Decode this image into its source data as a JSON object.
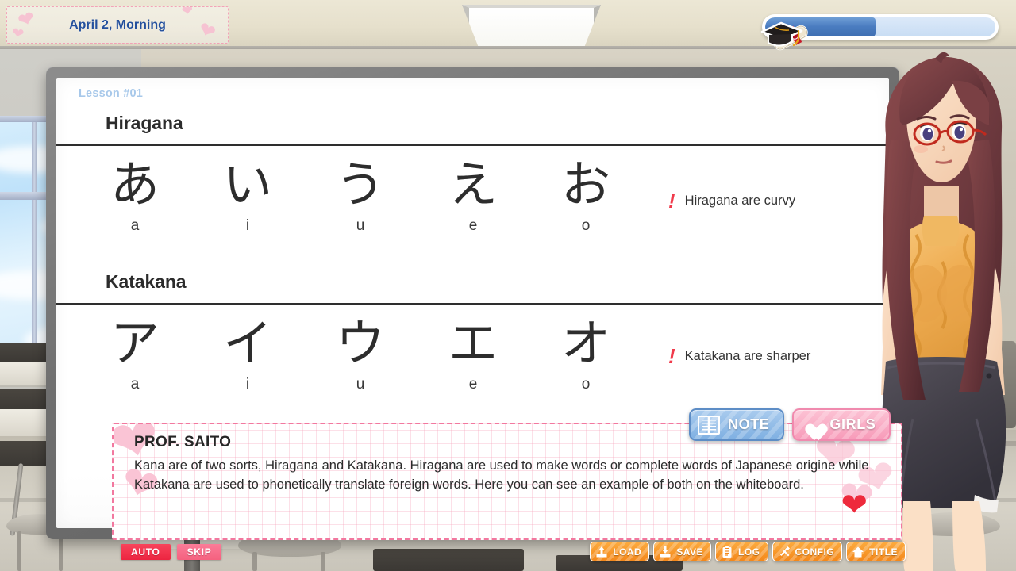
{
  "hud": {
    "date_label": "April 2, Morning",
    "progress_percent": 48,
    "progress_icon": "graduation-cap-diploma-icon",
    "progress_fill_color": "#4a7cc0",
    "progress_track_color": "#cfe0f5"
  },
  "whiteboard": {
    "lesson_label": "Lesson #01",
    "lesson_color": "#a7c8ea",
    "sections": [
      {
        "title": "Hiragana",
        "note_mark": "!",
        "note_text": "Hiragana are curvy",
        "kana": [
          {
            "glyph": "あ",
            "romaji": "a"
          },
          {
            "glyph": "い",
            "romaji": "i"
          },
          {
            "glyph": "う",
            "romaji": "u"
          },
          {
            "glyph": "え",
            "romaji": "e"
          },
          {
            "glyph": "お",
            "romaji": "o"
          }
        ]
      },
      {
        "title": "Katakana",
        "note_mark": "!",
        "note_text": "Katakana are sharper",
        "kana": [
          {
            "glyph": "ア",
            "romaji": "a"
          },
          {
            "glyph": "イ",
            "romaji": "i"
          },
          {
            "glyph": "ウ",
            "romaji": "u"
          },
          {
            "glyph": "エ",
            "romaji": "e"
          },
          {
            "glyph": "オ",
            "romaji": "o"
          }
        ]
      }
    ]
  },
  "tabs": [
    {
      "label": "NOTE",
      "icon": "book-icon",
      "color": "#7fb0e2"
    },
    {
      "label": "GIRLS",
      "icon": "heart-icon",
      "color": "#f79bb9"
    }
  ],
  "dialogue": {
    "speaker": "PROF. SAITO",
    "text": "Kana are of two sorts, Hiragana and Katakana. Hiragana are used to make words or complete words of Japanese origine while Katakana are used to phonetically translate foreign words. Here you can see an example of both on the whiteboard.",
    "border_color": "#f2789f"
  },
  "left_controls": [
    {
      "label": "AUTO",
      "color": "#ec2440"
    },
    {
      "label": "SKIP",
      "color": "#f5617f"
    }
  ],
  "system_buttons": [
    {
      "label": "LOAD",
      "icon": "upload-tray-icon"
    },
    {
      "label": "SAVE",
      "icon": "download-tray-icon"
    },
    {
      "label": "LOG",
      "icon": "clipboard-icon"
    },
    {
      "label": "CONFIG",
      "icon": "wrench-screwdriver-icon"
    },
    {
      "label": "TITLE",
      "icon": "home-icon"
    }
  ],
  "system_button_color": "#f4881a",
  "character": {
    "name": "prof-saito-sprite",
    "hair_color": "#6e3a3f",
    "sweater_color": "#f0b35e",
    "skirt_color": "#45424a",
    "glasses_color": "#c02a1e"
  }
}
